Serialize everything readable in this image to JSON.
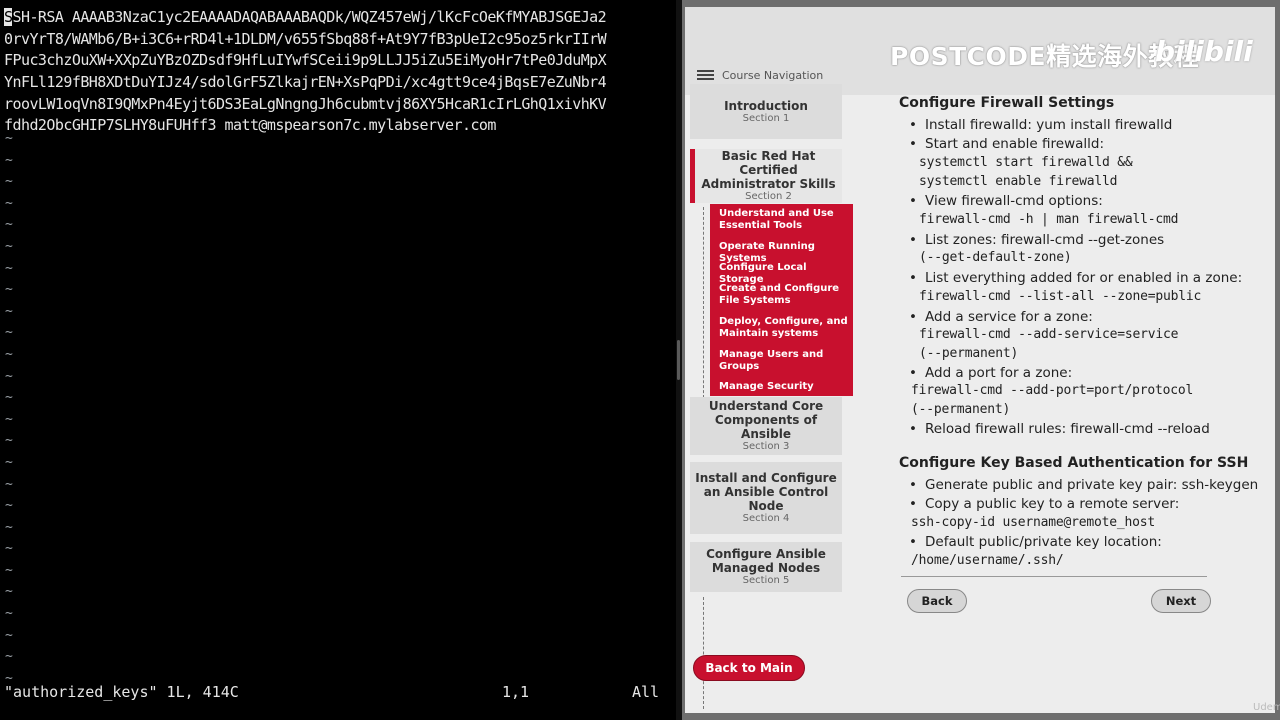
{
  "terminal": {
    "lines": [
      "SSH-RSA AAAAB3NzaC1yc2EAAAADAQABAAABAQDk/WQZ457eWj/lKcFcOeKfMYABJSGEJa2",
      "0rvYrT8/WAMb6/B+i3C6+rRD4l+1DLDM/v655fSbq88f+At9Y7fB3pUeI2c95oz5rkrIIrW",
      "FPuc3chzOuXW+XXpZuYBzOZDsdf9HfLuIYwfSCeii9p9LLJJ5iZu5EiMyoHr7tPe0JduMpX",
      "YnFLl129fBH8XDtDuYIJz4/sdolGrF5ZlkajrEN+XsPqPDi/xc4gtt9ce4jBqsE7eZuNbr4",
      "roovLW1oqVn8I9QMxPn4Eyjt6DS3EaLgNngngJh6cubmtvj86XY5HcaR1cIrLGhQ1xivhKV",
      "fdhd2ObcGHIP7SLHY8uFUHff3 matt@mspearson7c.mylabserver.com"
    ],
    "cursor_char": "S",
    "tilde": "~",
    "status_file": "\"authorized_keys\" 1L, 414C",
    "status_pos": "1,1",
    "status_all": "All"
  },
  "course": {
    "banner_text": "POSTCODE精选海外教程",
    "banner_logo": "bilibili",
    "nav_title": "Course Navigation",
    "sections": [
      {
        "title": "Introduction",
        "sub": "Section 1"
      },
      {
        "title": "Basic Red Hat Certified Administrator Skills",
        "sub": "Section 2"
      },
      {
        "title": "Understand Core Components of Ansible",
        "sub": "Section 3"
      },
      {
        "title": "Install and Configure an Ansible Control Node",
        "sub": "Section 4"
      },
      {
        "title": "Configure Ansible Managed Nodes",
        "sub": "Section 5"
      }
    ],
    "subitems": [
      "Understand and Use Essential Tools",
      "Operate Running Systems",
      "Configure Local Storage",
      "Create and Configure File Systems",
      "Deploy, Configure, and Maintain systems",
      "Manage Users and Groups",
      "Manage Security"
    ],
    "firewall": {
      "heading": "Configure Firewall Settings",
      "b1": "Install firewalld: yum install firewalld",
      "b2": "Start and enable firewalld:",
      "b2c1": "systemctl start firewalld &&",
      "b2c2": "systemctl enable firewalld",
      "b3": "View firewall-cmd options:",
      "b3c1": "firewall-cmd -h | man firewall-cmd",
      "b4": "List zones: firewall-cmd --get-zones",
      "b4c1": "(--get-default-zone)",
      "b5": "List everything added for or enabled in a zone:",
      "b5c1": "firewall-cmd --list-all --zone=public",
      "b6": "Add a service for a zone:",
      "b6c1": "firewall-cmd --add-service=service",
      "b6c2": "(--permanent)",
      "b7": "Add a port for a zone:",
      "b7c1": "firewall-cmd --add-port=port/protocol",
      "b7c2": "(--permanent)",
      "b8": "Reload firewall rules: firewall-cmd --reload"
    },
    "ssh": {
      "heading": "Configure Key Based Authentication for SSH",
      "b1": "Generate public and private key pair: ssh-keygen",
      "b2": "Copy a public key to a remote server:",
      "b2c1": "ssh-copy-id username@remote_host",
      "b3": "Default public/private key location:",
      "b3c1": "/home/username/.ssh/"
    },
    "back_label": "Back",
    "next_label": "Next",
    "main_label": "Back to Main",
    "watermark": "Udemy"
  },
  "colors": {
    "accent": "#c8102e",
    "terminal_bg": "#000000"
  }
}
